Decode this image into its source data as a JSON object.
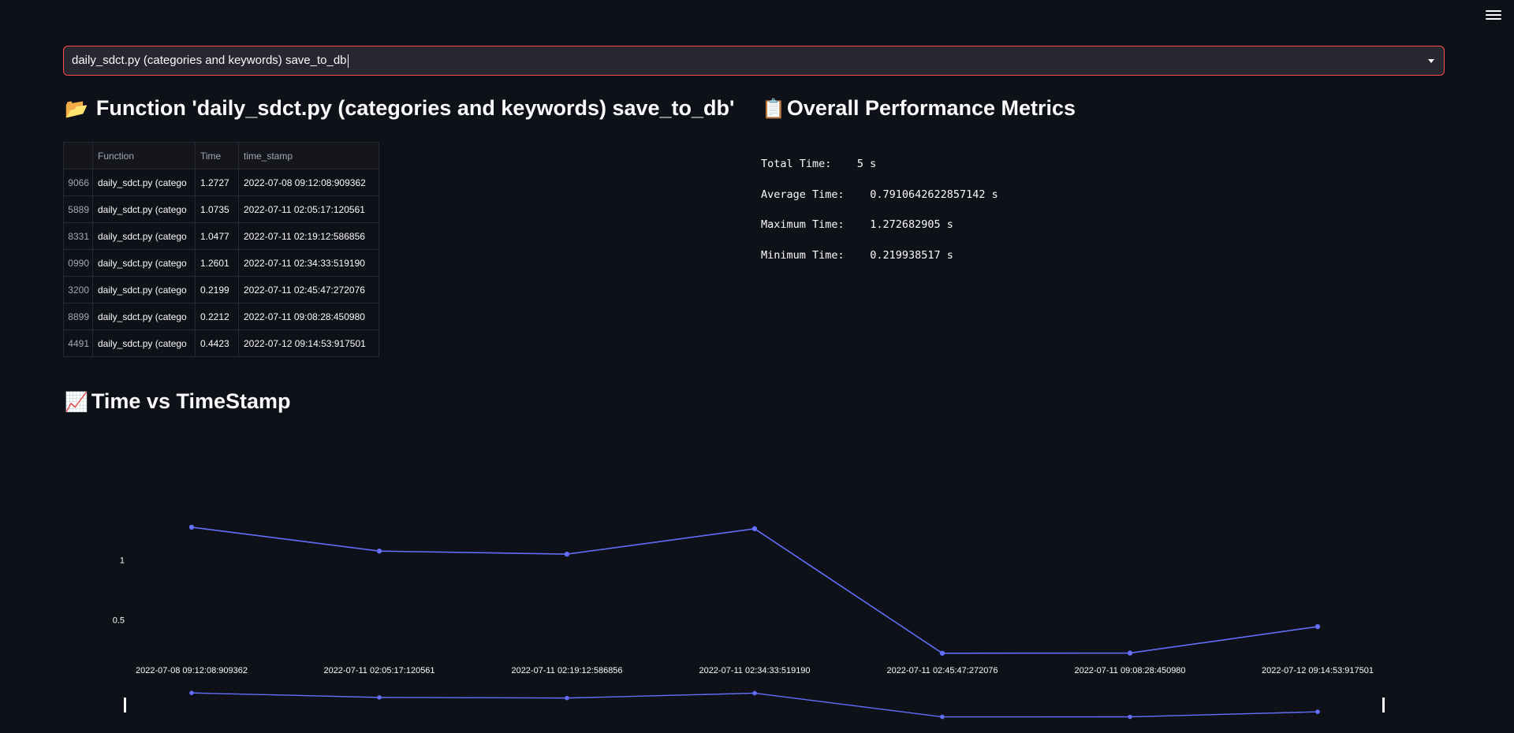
{
  "select": {
    "value": "daily_sdct.py (categories and keywords) save_to_db"
  },
  "function_section": {
    "emoji": "📂",
    "title": "Function 'daily_sdct.py (categories and keywords) save_to_db'"
  },
  "metrics_section": {
    "emoji": "📋",
    "title": "Overall Performance Metrics",
    "rows": [
      {
        "label": "Total Time:",
        "value": "5 s"
      },
      {
        "label": "Average Time:",
        "value": "0.7910642622857142 s"
      },
      {
        "label": "Maximum Time:",
        "value": "1.272682905 s"
      },
      {
        "label": "Minimum Time:",
        "value": "0.219938517 s"
      }
    ]
  },
  "table": {
    "columns": [
      "",
      "Function",
      "Time",
      "time_stamp"
    ],
    "rows": [
      {
        "index": "9066",
        "function": "daily_sdct.py (catego",
        "time": "1.2727",
        "time_stamp": "2022-07-08 09:12:08:909362"
      },
      {
        "index": "5889",
        "function": "daily_sdct.py (catego",
        "time": "1.0735",
        "time_stamp": "2022-07-11 02:05:17:120561"
      },
      {
        "index": "8331",
        "function": "daily_sdct.py (catego",
        "time": "1.0477",
        "time_stamp": "2022-07-11 02:19:12:586856"
      },
      {
        "index": "0990",
        "function": "daily_sdct.py (catego",
        "time": "1.2601",
        "time_stamp": "2022-07-11 02:34:33:519190"
      },
      {
        "index": "3200",
        "function": "daily_sdct.py (catego",
        "time": "0.2199",
        "time_stamp": "2022-07-11 02:45:47:272076"
      },
      {
        "index": "8899",
        "function": "daily_sdct.py (catego",
        "time": "0.2212",
        "time_stamp": "2022-07-11 09:08:28:450980"
      },
      {
        "index": "4491",
        "function": "daily_sdct.py (catego",
        "time": "0.4423",
        "time_stamp": "2022-07-12 09:14:53:917501"
      }
    ]
  },
  "chart_section": {
    "emoji": "📈",
    "title": "Time vs TimeStamp"
  },
  "chart_data": {
    "type": "line",
    "x": [
      "2022-07-08 09:12:08:909362",
      "2022-07-11 02:05:17:120561",
      "2022-07-11 02:19:12:586856",
      "2022-07-11 02:34:33:519190",
      "2022-07-11 02:45:47:272076",
      "2022-07-11 09:08:28:450980",
      "2022-07-12 09:14:53:917501"
    ],
    "series": [
      {
        "values": [
          1.2727,
          1.0735,
          1.0477,
          1.2601,
          0.2199,
          0.2212,
          0.4423
        ]
      }
    ],
    "y_ticks": [
      "0.5",
      "1"
    ],
    "ylim": [
      0.1,
      1.45
    ],
    "grid": false,
    "range_slider": true,
    "line_color": "#636efa"
  }
}
